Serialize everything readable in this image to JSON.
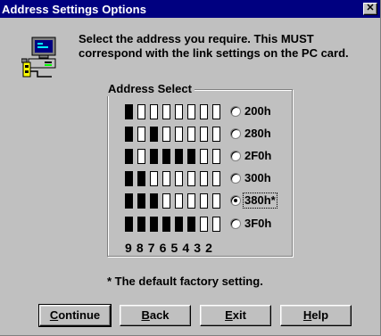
{
  "window": {
    "title": "Address Settings Options",
    "close_glyph": "✕"
  },
  "icon": "computer-network-icon",
  "instruction": "Select the address you require. This MUST\ncorrespond with the link settings on the  PC card.",
  "group": {
    "legend": "Address Select",
    "options": [
      {
        "label": "200h",
        "switches": [
          1,
          0,
          0,
          0,
          0,
          0,
          0,
          0
        ],
        "checked": false,
        "focused": false
      },
      {
        "label": "280h",
        "switches": [
          1,
          0,
          1,
          0,
          0,
          0,
          0,
          0
        ],
        "checked": false,
        "focused": false
      },
      {
        "label": "2F0h",
        "switches": [
          1,
          0,
          1,
          1,
          1,
          1,
          0,
          0
        ],
        "checked": false,
        "focused": false
      },
      {
        "label": "300h",
        "switches": [
          1,
          1,
          0,
          0,
          0,
          0,
          0,
          0
        ],
        "checked": false,
        "focused": false
      },
      {
        "label": "380h*",
        "switches": [
          1,
          1,
          1,
          0,
          0,
          0,
          0,
          0
        ],
        "checked": true,
        "focused": true
      },
      {
        "label": "3F0h",
        "switches": [
          1,
          1,
          1,
          1,
          1,
          1,
          0,
          0
        ],
        "checked": false,
        "focused": false
      }
    ],
    "switch_numbers": "9 8 7 6 5 4 3 2"
  },
  "footnote": "* The default factory setting.",
  "buttons": {
    "continue": {
      "mnemonic": "C",
      "rest": "ontinue"
    },
    "back": {
      "mnemonic": "B",
      "rest": "ack"
    },
    "exit": {
      "mnemonic": "E",
      "rest": "xit"
    },
    "help": {
      "mnemonic": "H",
      "rest": "elp"
    }
  },
  "colors": {
    "titlebar": "#000080",
    "face": "#c0c0c0",
    "switch_on": "#000000",
    "switch_off": "#ffffff"
  }
}
